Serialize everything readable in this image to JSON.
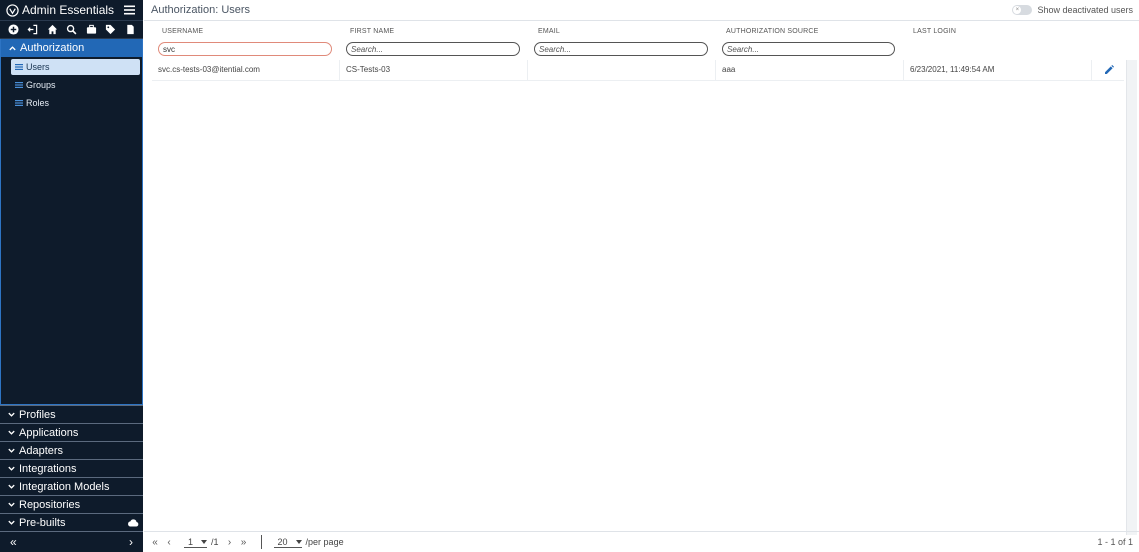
{
  "sidebar": {
    "app_title": "Admin Essentials",
    "toolbar_icons": [
      "add-circle-icon",
      "exit-icon",
      "home-icon",
      "search-icon",
      "briefcase-icon",
      "tag-icon",
      "document-icon"
    ],
    "open_section": {
      "label": "Authorization",
      "items": [
        {
          "label": "Users",
          "active": true
        },
        {
          "label": "Groups",
          "active": false
        },
        {
          "label": "Roles",
          "active": false
        }
      ]
    },
    "closed_sections": [
      {
        "label": "Profiles"
      },
      {
        "label": "Applications"
      },
      {
        "label": "Adapters"
      },
      {
        "label": "Integrations"
      },
      {
        "label": "Integration Models"
      },
      {
        "label": "Repositories"
      },
      {
        "label": "Pre-builts"
      }
    ],
    "footer": {
      "collapse": "«",
      "expand": "›"
    }
  },
  "main": {
    "title": "Authorization: Users",
    "toggle_label": "Show deactivated users",
    "columns": {
      "username": "USERNAME",
      "first_name": "FIRST NAME",
      "email": "EMAIL",
      "auth_source": "AUTHORIZATION SOURCE",
      "last_login": "LAST LOGIN"
    },
    "filters": {
      "username_value": "svc",
      "first_name_placeholder": "Search...",
      "email_placeholder": "Search...",
      "auth_source_placeholder": "Search..."
    },
    "rows": [
      {
        "username": "svc.cs-tests-03@itential.com",
        "first_name": "CS-Tests-03",
        "email": "",
        "auth_source": "aaa",
        "last_login": "6/23/2021, 11:49:54 AM"
      }
    ]
  },
  "pager": {
    "first": "«",
    "prev": "‹",
    "page": "1",
    "total_pages": "/1",
    "next": "›",
    "last": "»",
    "per_page": "20",
    "per_page_label": "/per page",
    "count": "1 - 1 of 1"
  },
  "colors": {
    "sidebar_bg": "#0e1b2b",
    "accent": "#2268b6",
    "active_item": "#cfe1f5"
  }
}
